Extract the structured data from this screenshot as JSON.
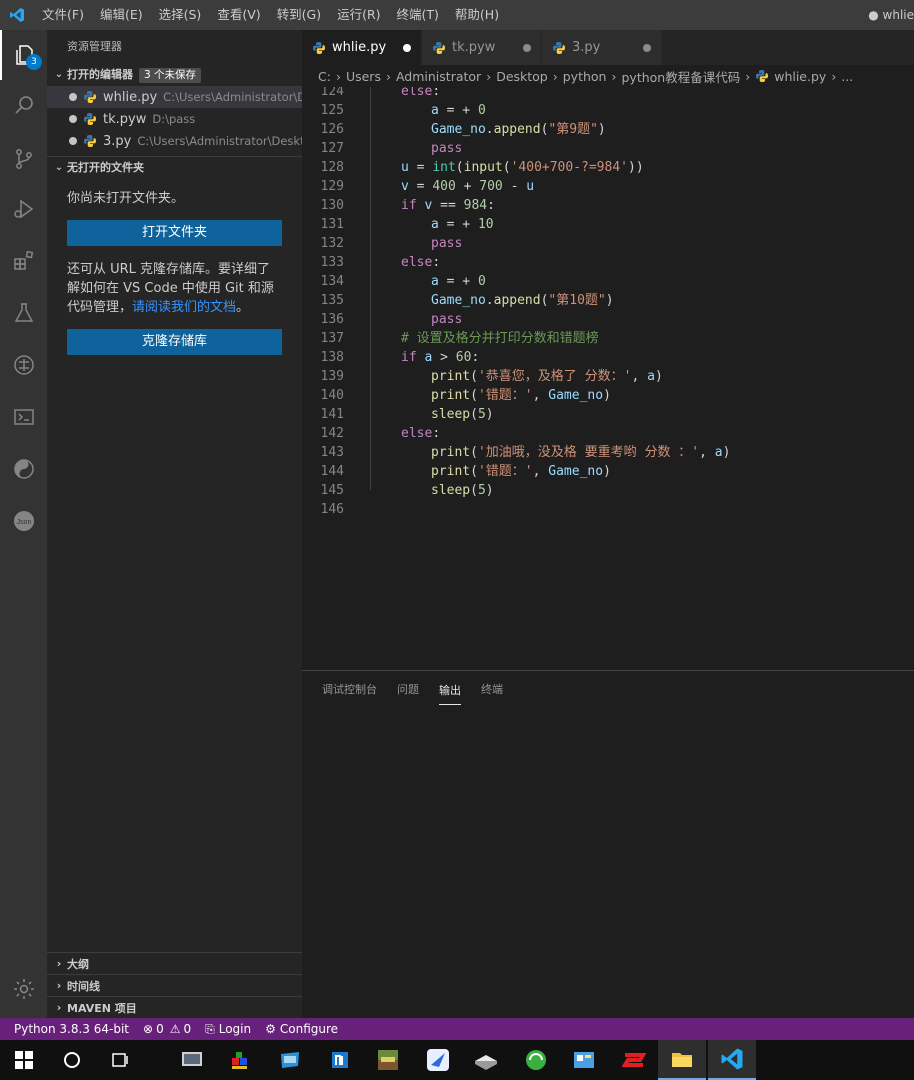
{
  "titlebar": {
    "menu": [
      "文件(F)",
      "编辑(E)",
      "选择(S)",
      "查看(V)",
      "转到(G)",
      "运行(R)",
      "终端(T)",
      "帮助(H)"
    ],
    "window_title": "● whlie"
  },
  "activity": {
    "explorer_badge": "3",
    "icons": [
      "files-icon",
      "search-icon",
      "source-control-icon",
      "run-debug-icon",
      "extensions-icon",
      "testing-icon",
      "remote-icon",
      "terminal-icon",
      "yin-yang-icon",
      "json-icon",
      "settings-gear-icon"
    ]
  },
  "sidebar": {
    "title": "资源管理器",
    "open_editors": {
      "header": "打开的编辑器",
      "dirty_badge": "3 个未保存",
      "files": [
        {
          "name": "whlie.py",
          "path": "C:\\Users\\Administrator\\De..."
        },
        {
          "name": "tk.pyw",
          "path": "D:\\pass"
        },
        {
          "name": "3.py",
          "path": "C:\\Users\\Administrator\\Deskto..."
        }
      ]
    },
    "no_folder": {
      "header": "无打开的文件夹",
      "text": "你尚未打开文件夹。",
      "open_folder_button": "打开文件夹",
      "clone_text_1": "还可从 URL 克隆存储库。要详细了解如何在 VS Code 中使用 Git 和源代码管理，",
      "clone_link": "请阅读我们的文档",
      "clone_text_2": "。",
      "clone_button": "克隆存储库"
    },
    "bottom_sections": [
      "大纲",
      "时间线",
      "MAVEN 项目"
    ]
  },
  "tabs": [
    {
      "label": "whlie.py",
      "active": true
    },
    {
      "label": "tk.pyw",
      "active": false
    },
    {
      "label": "3.py",
      "active": false
    }
  ],
  "breadcrumb": [
    "C:",
    "Users",
    "Administrator",
    "Desktop",
    "python",
    "python教程备课代码",
    "whlie.py",
    "..."
  ],
  "editor": {
    "lines": [
      {
        "n": "124",
        "indent": 1,
        "code": "else:"
      },
      {
        "n": "125",
        "indent": 2,
        "code": "a = + 0"
      },
      {
        "n": "126",
        "indent": 2,
        "code": "Game_no.append(\"第9题\")"
      },
      {
        "n": "127",
        "indent": 2,
        "code": "pass"
      },
      {
        "n": "128",
        "indent": 1,
        "code": "u = int(input('400+700-?=984'))"
      },
      {
        "n": "129",
        "indent": 1,
        "code": "v = 400 + 700 - u"
      },
      {
        "n": "130",
        "indent": 1,
        "code": "if v == 984:"
      },
      {
        "n": "131",
        "indent": 2,
        "code": "a = + 10"
      },
      {
        "n": "132",
        "indent": 2,
        "code": "pass"
      },
      {
        "n": "133",
        "indent": 1,
        "code": "else:"
      },
      {
        "n": "134",
        "indent": 2,
        "code": "a = + 0"
      },
      {
        "n": "135",
        "indent": 2,
        "code": "Game_no.append(\"第10题\")"
      },
      {
        "n": "136",
        "indent": 2,
        "code": "pass"
      },
      {
        "n": "137",
        "indent": 1,
        "code": "# 设置及格分并打印分数和错题榜"
      },
      {
        "n": "138",
        "indent": 1,
        "code": "if a > 60:"
      },
      {
        "n": "139",
        "indent": 2,
        "code": "print('恭喜您，及格了 分数：', a)"
      },
      {
        "n": "140",
        "indent": 2,
        "code": "print('错题：', Game_no)"
      },
      {
        "n": "141",
        "indent": 2,
        "code": "sleep(5)"
      },
      {
        "n": "142",
        "indent": 1,
        "code": "else:"
      },
      {
        "n": "143",
        "indent": 2,
        "code": "print('加油哦，没及格 要重考哟 分数 ：', a)"
      },
      {
        "n": "144",
        "indent": 2,
        "code": "print('错题：', Game_no)"
      },
      {
        "n": "145",
        "indent": 2,
        "code": "sleep(5)"
      },
      {
        "n": "146",
        "indent": 0,
        "code": ""
      }
    ]
  },
  "panel": {
    "tabs": [
      "调试控制台",
      "问题",
      "输出",
      "终端"
    ],
    "active": "输出"
  },
  "status": {
    "python": "Python 3.8.3 64-bit",
    "errors": "0",
    "warnings": "0",
    "login": "Login",
    "configure": "Configure"
  },
  "colors": {
    "status_bar": "#68217a",
    "activity_bar": "#333333",
    "sidebar": "#252526",
    "editor": "#1e1e1e",
    "button": "#0e639c"
  }
}
